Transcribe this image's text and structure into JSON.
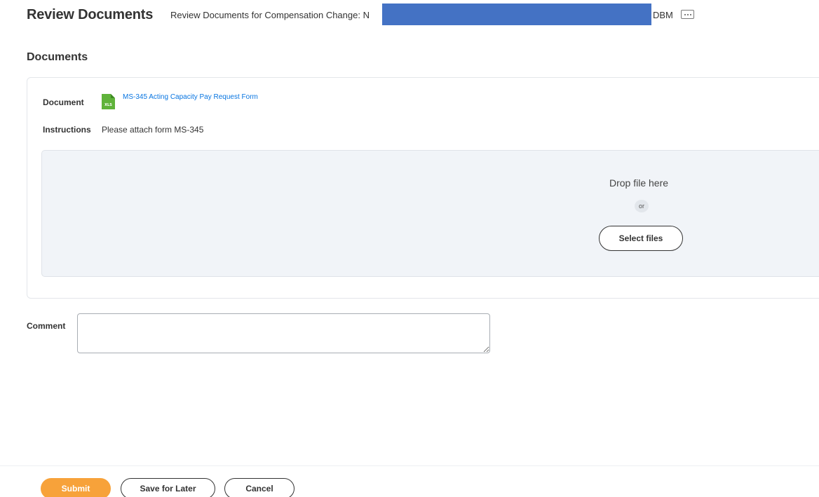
{
  "header": {
    "title": "Review Documents",
    "subtitle": "Review Documents for Compensation Change: N",
    "subtitle_suffix": "DBM",
    "redaction_color": "#4472c4",
    "related_actions_icon": "ellipsis-icon"
  },
  "documents": {
    "section_title": "Documents",
    "document_label": "Document",
    "document_icon": "xls-file-icon",
    "document_icon_text": "XLS",
    "document_link": "MS-345 Acting Capacity Pay Request Form",
    "instructions_label": "Instructions",
    "instructions_value": "Please attach form MS-345",
    "dropzone": {
      "drop_text": "Drop file here",
      "or_text": "or",
      "select_label": "Select files"
    }
  },
  "comment": {
    "label": "Comment",
    "value": ""
  },
  "footer": {
    "submit_label": "Submit",
    "save_label": "Save for Later",
    "cancel_label": "Cancel"
  },
  "colors": {
    "accent": "#f7a23a",
    "link": "#0875e1",
    "xls_green": "#5fb33a"
  }
}
